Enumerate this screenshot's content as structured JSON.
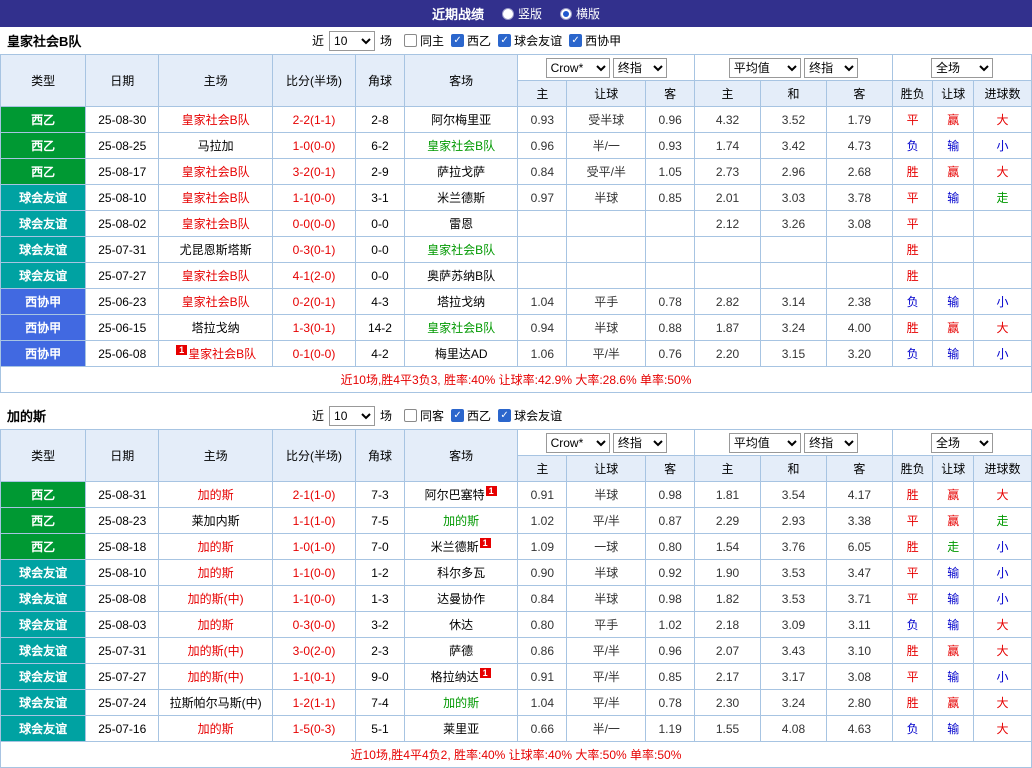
{
  "topbar": {
    "title": "近期战绩",
    "layout_options": [
      {
        "label": "竖版",
        "selected": false
      },
      {
        "label": "横版",
        "selected": true
      }
    ]
  },
  "columns": {
    "type": "类型",
    "date": "日期",
    "home": "主场",
    "score": "比分(半场)",
    "corners": "角球",
    "away": "客场",
    "odds_home": "主",
    "odds_handicap": "让球",
    "odds_away": "客",
    "avg_home": "主",
    "avg_draw": "和",
    "avg_away": "客",
    "result": "胜负",
    "handicap_result": "让球",
    "goals": "进球数"
  },
  "league_colors": {
    "西乙": "#009933",
    "球会友谊": "#00a2a2",
    "西协甲": "#4169e1"
  },
  "status_colors": {
    "win": "#e60000",
    "loss": "#0000cc",
    "push": "#009900"
  },
  "tables": [
    {
      "team": "皇家社会B队",
      "filter": {
        "near_label": "近",
        "near_value": "10",
        "games_label": "场",
        "checkboxes": [
          {
            "label": "同主",
            "checked": false
          },
          {
            "label": "西乙",
            "checked": true
          },
          {
            "label": "球会友谊",
            "checked": true
          },
          {
            "label": "西协甲",
            "checked": true
          }
        ]
      },
      "selects": {
        "bookmaker": "Crow*",
        "bookmaker_type": "终指",
        "average": "平均值",
        "average_type": "终指",
        "scope": "全场"
      },
      "rows": [
        {
          "league": "西乙",
          "date": "25-08-30",
          "home": {
            "name": "皇家社会B队",
            "color": "red"
          },
          "score": "2-2(1-1)",
          "corners": "2-8",
          "away": {
            "name": "阿尔梅里亚"
          },
          "odds": [
            "0.93",
            "受半球",
            "0.96"
          ],
          "avg": [
            "4.32",
            "3.52",
            "1.79"
          ],
          "results": [
            "平",
            "赢",
            "大"
          ]
        },
        {
          "league": "西乙",
          "date": "25-08-25",
          "home": {
            "name": "马拉加"
          },
          "score": "1-0(0-0)",
          "corners": "6-2",
          "away": {
            "name": "皇家社会B队",
            "color": "green"
          },
          "odds": [
            "0.96",
            "半/一",
            "0.93"
          ],
          "avg": [
            "1.74",
            "3.42",
            "4.73"
          ],
          "results": [
            "负",
            "输",
            "小"
          ]
        },
        {
          "league": "西乙",
          "date": "25-08-17",
          "home": {
            "name": "皇家社会B队",
            "color": "red"
          },
          "score": "3-2(0-1)",
          "corners": "2-9",
          "away": {
            "name": "萨拉戈萨"
          },
          "odds": [
            "0.84",
            "受平/半",
            "1.05"
          ],
          "avg": [
            "2.73",
            "2.96",
            "2.68"
          ],
          "results": [
            "胜",
            "赢",
            "大"
          ]
        },
        {
          "league": "球会友谊",
          "date": "25-08-10",
          "home": {
            "name": "皇家社会B队",
            "color": "red"
          },
          "score": "1-1(0-0)",
          "corners": "3-1",
          "away": {
            "name": "米兰德斯"
          },
          "odds": [
            "0.97",
            "半球",
            "0.85"
          ],
          "avg": [
            "2.01",
            "3.03",
            "3.78"
          ],
          "results": [
            "平",
            "输",
            "走"
          ]
        },
        {
          "league": "球会友谊",
          "date": "25-08-02",
          "home": {
            "name": "皇家社会B队",
            "color": "red"
          },
          "score": "0-0(0-0)",
          "corners": "0-0",
          "away": {
            "name": "雷恩"
          },
          "odds": [
            "",
            "",
            ""
          ],
          "avg": [
            "2.12",
            "3.26",
            "3.08"
          ],
          "results": [
            "平",
            "",
            ""
          ]
        },
        {
          "league": "球会友谊",
          "date": "25-07-31",
          "home": {
            "name": "尤昆恩斯塔斯"
          },
          "score": "0-3(0-1)",
          "corners": "0-0",
          "away": {
            "name": "皇家社会B队",
            "color": "green"
          },
          "odds": [
            "",
            "",
            ""
          ],
          "avg": [
            "",
            "",
            ""
          ],
          "results": [
            "胜",
            "",
            ""
          ]
        },
        {
          "league": "球会友谊",
          "date": "25-07-27",
          "home": {
            "name": "皇家社会B队",
            "color": "red"
          },
          "score": "4-1(2-0)",
          "corners": "0-0",
          "away": {
            "name": "奥萨苏纳B队"
          },
          "odds": [
            "",
            "",
            ""
          ],
          "avg": [
            "",
            "",
            ""
          ],
          "results": [
            "胜",
            "",
            ""
          ]
        },
        {
          "league": "西协甲",
          "date": "25-06-23",
          "home": {
            "name": "皇家社会B队",
            "color": "red"
          },
          "score": "0-2(0-1)",
          "corners": "4-3",
          "away": {
            "name": "塔拉戈纳"
          },
          "odds": [
            "1.04",
            "平手",
            "0.78"
          ],
          "avg": [
            "2.82",
            "3.14",
            "2.38"
          ],
          "results": [
            "负",
            "输",
            "小"
          ]
        },
        {
          "league": "西协甲",
          "date": "25-06-15",
          "home": {
            "name": "塔拉戈纳"
          },
          "score": "1-3(0-1)",
          "corners": "14-2",
          "away": {
            "name": "皇家社会B队",
            "color": "green"
          },
          "odds": [
            "0.94",
            "半球",
            "0.88"
          ],
          "avg": [
            "1.87",
            "3.24",
            "4.00"
          ],
          "results": [
            "胜",
            "赢",
            "大"
          ]
        },
        {
          "league": "西协甲",
          "date": "25-06-08",
          "home": {
            "name": "皇家社会B队",
            "color": "red",
            "badge": "1",
            "badge_pos": "before"
          },
          "score": "0-1(0-0)",
          "corners": "4-2",
          "away": {
            "name": "梅里达AD"
          },
          "odds": [
            "1.06",
            "平/半",
            "0.76"
          ],
          "avg": [
            "2.20",
            "3.15",
            "3.20"
          ],
          "results": [
            "负",
            "输",
            "小"
          ]
        }
      ],
      "summary": "近10场,胜4平3负3, 胜率:40% 让球率:42.9% 大率:28.6% 单率:50%"
    },
    {
      "team": "加的斯",
      "filter": {
        "near_label": "近",
        "near_value": "10",
        "games_label": "场",
        "checkboxes": [
          {
            "label": "同客",
            "checked": false
          },
          {
            "label": "西乙",
            "checked": true
          },
          {
            "label": "球会友谊",
            "checked": true
          }
        ]
      },
      "selects": {
        "bookmaker": "Crow*",
        "bookmaker_type": "终指",
        "average": "平均值",
        "average_type": "终指",
        "scope": "全场"
      },
      "rows": [
        {
          "league": "西乙",
          "date": "25-08-31",
          "home": {
            "name": "加的斯",
            "color": "red"
          },
          "score": "2-1(1-0)",
          "corners": "7-3",
          "away": {
            "name": "阿尔巴塞特",
            "badge": "1",
            "badge_pos": "after"
          },
          "odds": [
            "0.91",
            "半球",
            "0.98"
          ],
          "avg": [
            "1.81",
            "3.54",
            "4.17"
          ],
          "results": [
            "胜",
            "赢",
            "大"
          ]
        },
        {
          "league": "西乙",
          "date": "25-08-23",
          "home": {
            "name": "莱加内斯"
          },
          "score": "1-1(1-0)",
          "corners": "7-5",
          "away": {
            "name": "加的斯",
            "color": "green"
          },
          "odds": [
            "1.02",
            "平/半",
            "0.87"
          ],
          "avg": [
            "2.29",
            "2.93",
            "3.38"
          ],
          "results": [
            "平",
            "赢",
            "走"
          ]
        },
        {
          "league": "西乙",
          "date": "25-08-18",
          "home": {
            "name": "加的斯",
            "color": "red"
          },
          "score": "1-0(1-0)",
          "corners": "7-0",
          "away": {
            "name": "米兰德斯",
            "badge": "1",
            "badge_pos": "after"
          },
          "odds": [
            "1.09",
            "一球",
            "0.80"
          ],
          "avg": [
            "1.54",
            "3.76",
            "6.05"
          ],
          "results": [
            "胜",
            "走",
            "小"
          ]
        },
        {
          "league": "球会友谊",
          "date": "25-08-10",
          "home": {
            "name": "加的斯",
            "color": "red"
          },
          "score": "1-1(0-0)",
          "corners": "1-2",
          "away": {
            "name": "科尔多瓦"
          },
          "odds": [
            "0.90",
            "半球",
            "0.92"
          ],
          "avg": [
            "1.90",
            "3.53",
            "3.47"
          ],
          "results": [
            "平",
            "输",
            "小"
          ]
        },
        {
          "league": "球会友谊",
          "date": "25-08-08",
          "home": {
            "name": "加的斯(中)",
            "color": "red"
          },
          "score": "1-1(0-0)",
          "corners": "1-3",
          "away": {
            "name": "达曼协作"
          },
          "odds": [
            "0.84",
            "半球",
            "0.98"
          ],
          "avg": [
            "1.82",
            "3.53",
            "3.71"
          ],
          "results": [
            "平",
            "输",
            "小"
          ]
        },
        {
          "league": "球会友谊",
          "date": "25-08-03",
          "home": {
            "name": "加的斯",
            "color": "red"
          },
          "score": "0-3(0-0)",
          "corners": "3-2",
          "away": {
            "name": "休达"
          },
          "odds": [
            "0.80",
            "平手",
            "1.02"
          ],
          "avg": [
            "2.18",
            "3.09",
            "3.11"
          ],
          "results": [
            "负",
            "输",
            "大"
          ]
        },
        {
          "league": "球会友谊",
          "date": "25-07-31",
          "home": {
            "name": "加的斯(中)",
            "color": "red"
          },
          "score": "3-0(2-0)",
          "corners": "2-3",
          "away": {
            "name": "萨德"
          },
          "odds": [
            "0.86",
            "平/半",
            "0.96"
          ],
          "avg": [
            "2.07",
            "3.43",
            "3.10"
          ],
          "results": [
            "胜",
            "赢",
            "大"
          ]
        },
        {
          "league": "球会友谊",
          "date": "25-07-27",
          "home": {
            "name": "加的斯(中)",
            "color": "red"
          },
          "score": "1-1(0-1)",
          "corners": "9-0",
          "away": {
            "name": "格拉纳达",
            "badge": "1",
            "badge_pos": "after"
          },
          "odds": [
            "0.91",
            "平/半",
            "0.85"
          ],
          "avg": [
            "2.17",
            "3.17",
            "3.08"
          ],
          "results": [
            "平",
            "输",
            "小"
          ]
        },
        {
          "league": "球会友谊",
          "date": "25-07-24",
          "home": {
            "name": "拉斯帕尔马斯(中)"
          },
          "score": "1-2(1-1)",
          "corners": "7-4",
          "away": {
            "name": "加的斯",
            "color": "green"
          },
          "odds": [
            "1.04",
            "平/半",
            "0.78"
          ],
          "avg": [
            "2.30",
            "3.24",
            "2.80"
          ],
          "results": [
            "胜",
            "赢",
            "大"
          ]
        },
        {
          "league": "球会友谊",
          "date": "25-07-16",
          "home": {
            "name": "加的斯",
            "color": "red"
          },
          "score": "1-5(0-3)",
          "corners": "5-1",
          "away": {
            "name": "莱里亚"
          },
          "odds": [
            "0.66",
            "半/一",
            "1.19"
          ],
          "avg": [
            "1.55",
            "4.08",
            "4.63"
          ],
          "results": [
            "负",
            "输",
            "大"
          ]
        }
      ],
      "summary": "近10场,胜4平4负2, 胜率:40% 让球率:40% 大率:50% 单率:50%"
    }
  ]
}
